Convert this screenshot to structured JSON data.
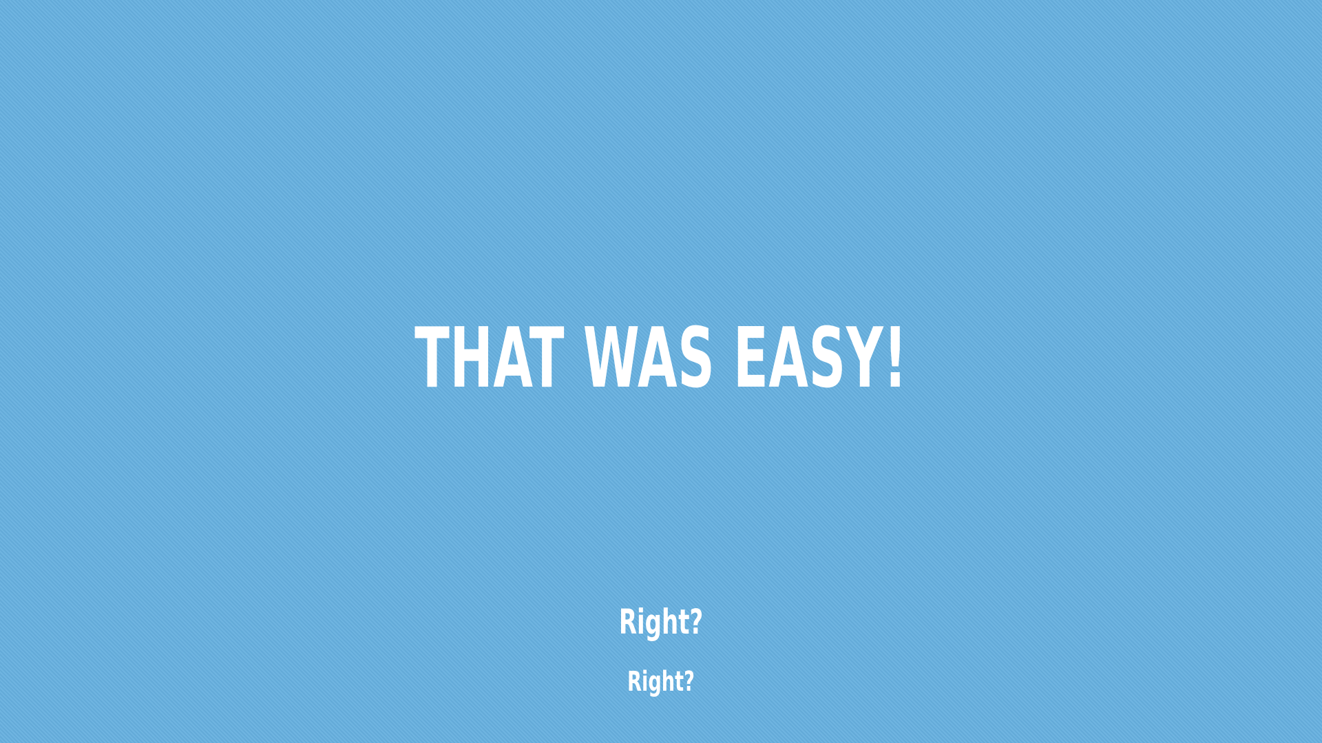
{
  "slide": {
    "background_color": "#66b0df",
    "text_color": "#ffffff",
    "headline": "THAT WAS EASY!",
    "subline_1": "Right?",
    "subline_2": "Right?"
  }
}
